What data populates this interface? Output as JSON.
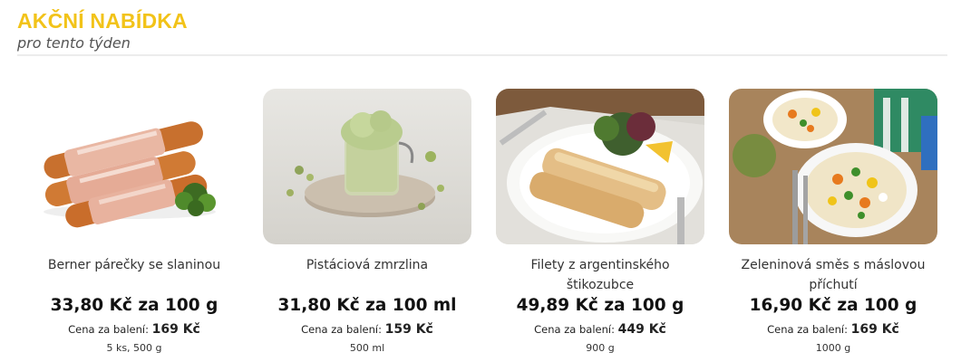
{
  "header": {
    "title": "AKČNÍ NABÍDKA",
    "subtitle": "pro tento týden"
  },
  "products": [
    {
      "name": "Berner párečky se slaninou",
      "unit_price": "33,80 Kč za 100 g",
      "pack_label": "Cena za balení:",
      "pack_price": "169 Kč",
      "size": "5 ks, 500 g",
      "image_icon": "sausages-bacon-image"
    },
    {
      "name": "Pistáciová zmrzlina",
      "unit_price": "31,80 Kč za 100 ml",
      "pack_label": "Cena za balení:",
      "pack_price": "159 Kč",
      "size": "500 ml",
      "image_icon": "pistachio-ice-cream-image"
    },
    {
      "name": "Filety z argentinského štikozubce",
      "unit_price": "49,89 Kč za 100 g",
      "pack_label": "Cena za balení:",
      "pack_price": "449 Kč",
      "size": "900 g",
      "image_icon": "fish-fillet-image"
    },
    {
      "name": "Zeleninová směs s máslovou příchutí",
      "unit_price": "16,90 Kč za 100 g",
      "pack_label": "Cena za balení:",
      "pack_price": "169 Kč",
      "size": "1000 g",
      "image_icon": "vegetable-mix-image"
    }
  ],
  "colors": {
    "title": "#f2c319",
    "divider": "#ececec"
  }
}
